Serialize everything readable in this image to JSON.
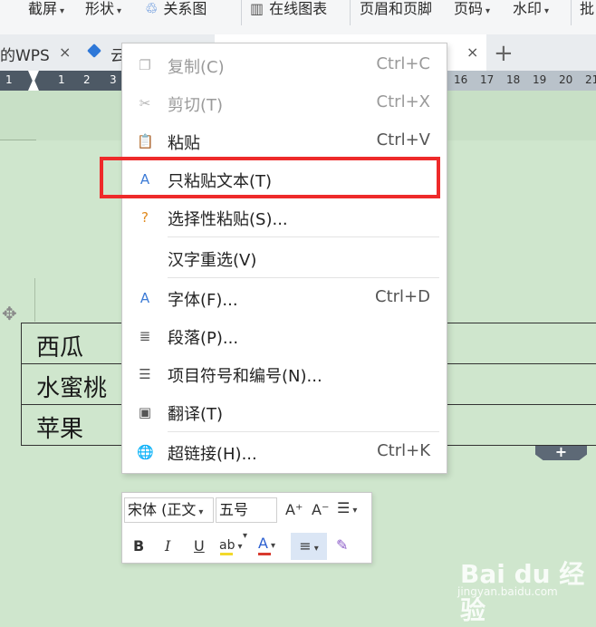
{
  "toolbar": {
    "items": [
      {
        "label": "截屏",
        "has_caret": true
      },
      {
        "label": "形状",
        "has_caret": true
      },
      {
        "label": "关系图",
        "icon": "relation-icon"
      },
      {
        "label": "在线图表",
        "icon": "chart-icon"
      },
      {
        "label": "页眉和页脚"
      },
      {
        "label": "页码",
        "has_caret": true
      },
      {
        "label": "水印",
        "has_caret": true
      },
      {
        "label": "批"
      }
    ]
  },
  "tabs": [
    {
      "label": "的WPS",
      "close": "×"
    },
    {
      "label": "云",
      "icon": "cloud-doc-icon"
    },
    {
      "label": "",
      "close": "×",
      "active": true
    }
  ],
  "ruler": {
    "left_ticks": [
      "1",
      "1",
      "2",
      "3"
    ],
    "right_ticks": [
      "16",
      "17",
      "18",
      "19",
      "20",
      "21"
    ]
  },
  "table": {
    "rows": [
      "西瓜",
      "水蜜桃",
      "苹果"
    ]
  },
  "context_menu": {
    "items": [
      {
        "label": "复制(C)",
        "shortcut": "Ctrl+C",
        "icon": "copy-icon",
        "disabled": true
      },
      {
        "label": "剪切(T)",
        "shortcut": "Ctrl+X",
        "icon": "scissors-icon",
        "disabled": true
      },
      {
        "label": "粘贴",
        "shortcut": "Ctrl+V",
        "icon": "paste-icon"
      },
      {
        "label": "只粘贴文本(T)",
        "shortcut": "",
        "icon": "paste-text-icon",
        "highlighted": true
      },
      {
        "label": "选择性粘贴(S)...",
        "shortcut": "",
        "icon": "paste-special-icon"
      },
      {
        "label": "汉字重选(V)",
        "shortcut": ""
      },
      {
        "label": "字体(F)...",
        "shortcut": "Ctrl+D",
        "icon": "font-icon"
      },
      {
        "label": "段落(P)...",
        "shortcut": "",
        "icon": "paragraph-icon"
      },
      {
        "label": "项目符号和编号(N)...",
        "shortcut": "",
        "icon": "bullet-list-icon"
      },
      {
        "label": "翻译(T)",
        "shortcut": "",
        "icon": "translate-icon"
      },
      {
        "label": "超链接(H)...",
        "shortcut": "Ctrl+K",
        "icon": "hyperlink-icon"
      }
    ]
  },
  "mini_toolbar": {
    "font_name": "宋体 (正文",
    "font_size": "五号",
    "grow_font": "A⁺",
    "shrink_font": "A⁻",
    "bold": "B",
    "italic": "I",
    "underline": "U",
    "highlight_label": "ab",
    "font_color_label": "A"
  },
  "colors": {
    "accent": "#3c7bd6",
    "highlight_box": "#ee2a2a",
    "doc_background": "#cfe6cd",
    "highlight_yellow": "#f2d92b",
    "font_color_red": "#d83a2e"
  },
  "watermark": {
    "brand": "Bai du 经验",
    "url": "jingyan.baidu.com"
  }
}
